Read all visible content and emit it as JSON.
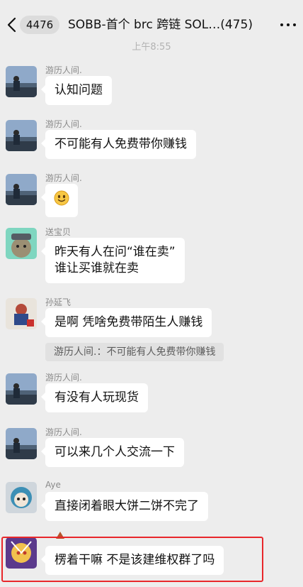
{
  "header": {
    "unread_count": "4476",
    "title": "SOBB-首个 brc 跨链 SOL…(475)"
  },
  "timestamp": "上午8:55",
  "messages": [
    {
      "sender": "游历人间.",
      "text": "认知问题"
    },
    {
      "sender": "游历人间.",
      "text": "不可能有人免费带你赚钱"
    },
    {
      "sender": "游历人间.",
      "emoji": "smiling-face-emoji"
    },
    {
      "sender": "送宝贝",
      "lines": [
        "昨天有人在问“谁在卖”",
        "谁让买谁就在卖"
      ]
    },
    {
      "sender": "孙延飞",
      "text": "是啊  凭啥免费带陌生人赚钱",
      "quote": "游历人间.：不可能有人免费带你赚钱"
    },
    {
      "sender": "游历人间.",
      "text": "有没有人玩现货"
    },
    {
      "sender": "游历人间.",
      "text": "可以来几个人交流一下"
    },
    {
      "sender": "Aye",
      "text": "直接闭着眼大饼二饼不完了"
    },
    {
      "sender": "",
      "text": "楞着干嘛 不是该建维权群了吗",
      "highlighted": true
    }
  ],
  "colors": {
    "background": "#ededed",
    "bubble": "#ffffff",
    "highlight": "#e8272b"
  }
}
